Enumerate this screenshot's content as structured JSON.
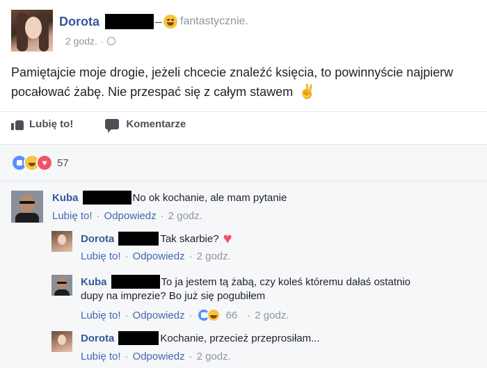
{
  "post": {
    "author": "Dorota",
    "dash": "–",
    "feeling": "fantastycznie.",
    "time": "2 godz. ·",
    "text": "Pamiętajcie moje drogie, jeżeli chcecie znaleźć księcia, to powinnyście najpierw pocałować żabę. Nie przespać się z całym stawem",
    "victory_emoji": "✌"
  },
  "actions": {
    "like": "Lubię to!",
    "comment": "Komentarze"
  },
  "reactions": {
    "count": "57"
  },
  "comments": [
    {
      "author": "Kuba",
      "text": "No ok kochanie, ale mam pytanie",
      "like": "Lubię to!",
      "reply": "Odpowiedz",
      "time": "2 godz."
    },
    {
      "author": "Dorota",
      "text": "Tak skarbie?",
      "like": "Lubię to!",
      "reply": "Odpowiedz",
      "time": "2 godz."
    },
    {
      "author": "Kuba",
      "text_line1": "To ja jestem tą żabą, czy koleś któremu dałaś ostatnio",
      "text_line2": "dupy na imprezie? Bo już się pogubiłem",
      "like": "Lubię to!",
      "reply": "Odpowiedz",
      "reactions": "66",
      "time": "2 godz."
    },
    {
      "author": "Dorota",
      "text": "Kochanie, przecież przeprosiłam...",
      "like": "Lubię to!",
      "reply": "Odpowiedz",
      "time": "2 godz."
    }
  ],
  "separator": "·",
  "colors": {
    "link": "#365899",
    "muted": "#90949c",
    "background": "#f6f7f9",
    "love": "#f25268",
    "like_blue": "#5890ff"
  }
}
